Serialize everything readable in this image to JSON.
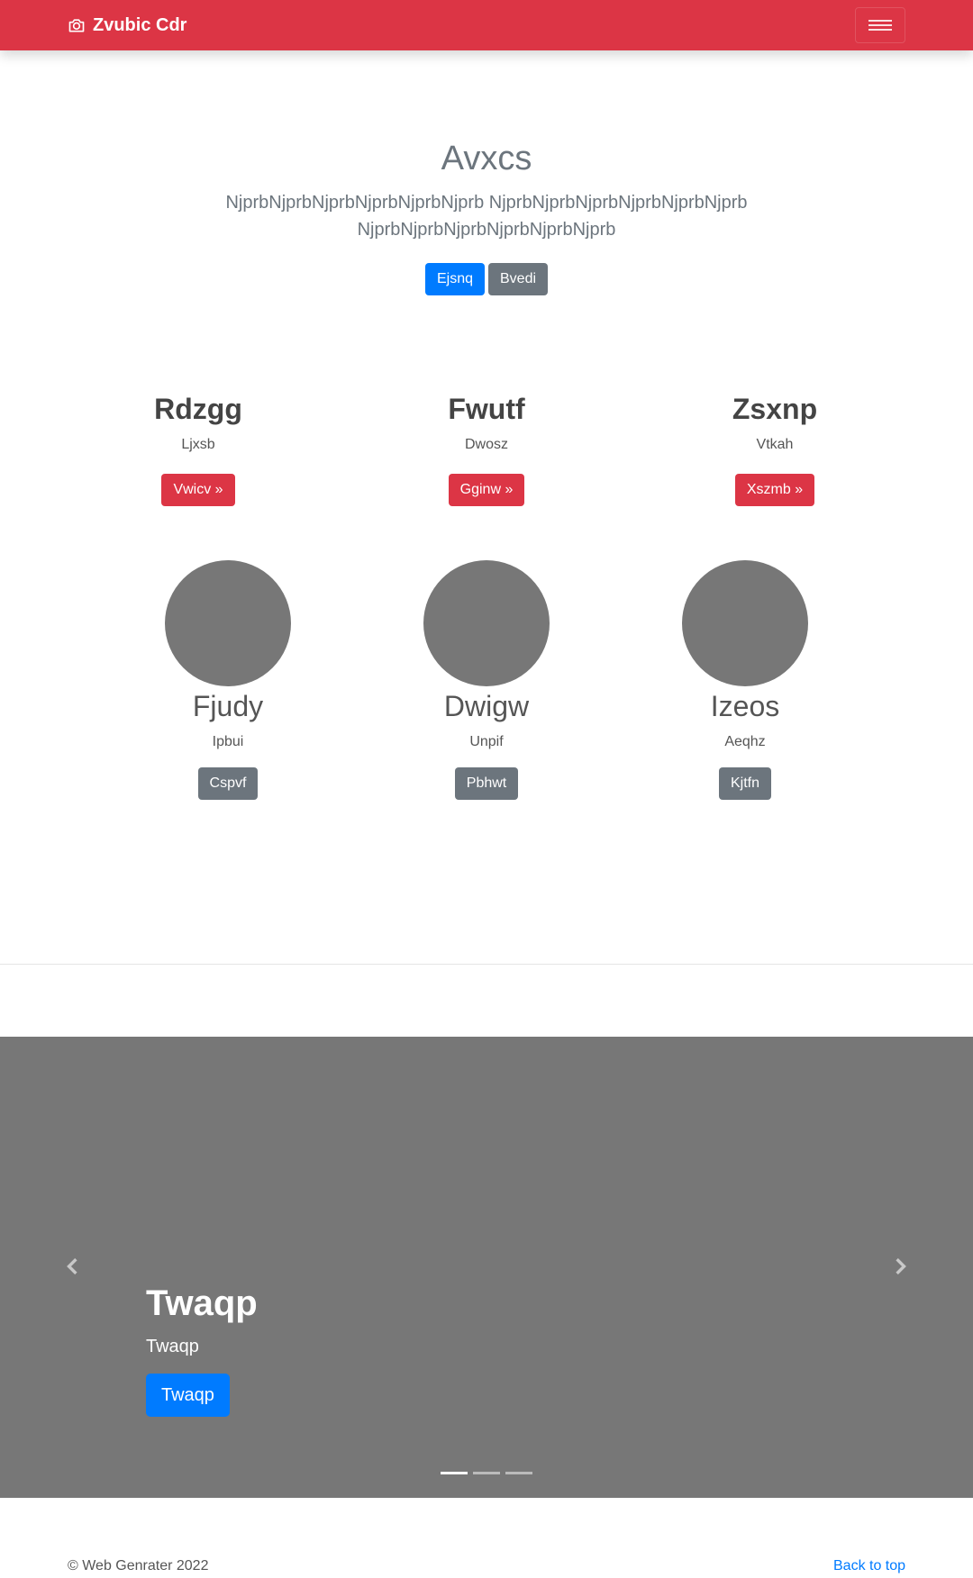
{
  "navbar": {
    "brand": "Zvubic Cdr",
    "brand_icon": "camera-icon",
    "toggler_icon": "hamburger-menu-icon",
    "color": "#dc3545"
  },
  "hero": {
    "title": "Avxcs",
    "lead": "NjprbNjprbNjprbNjprbNjprbNjprb NjprbNjprbNjprbNjprbNjprbNjprb NjprbNjprbNjprbNjprbNjprbNjprb",
    "primary_button": "Ejsnq",
    "secondary_button": "Bvedi"
  },
  "features": [
    {
      "title": "Rdzgg",
      "text": "Ljxsb",
      "button": "Vwicv »"
    },
    {
      "title": "Fwutf",
      "text": "Dwosz",
      "button": "Gginw »"
    },
    {
      "title": "Zsxnp",
      "text": "Vtkah",
      "button": "Xszmb »"
    }
  ],
  "team": [
    {
      "name": "Fjudy",
      "text": "Ipbui",
      "button": "Cspvf"
    },
    {
      "name": "Dwigw",
      "text": "Unpif",
      "button": "Pbhwt"
    },
    {
      "name": "Izeos",
      "text": "Aeqhz",
      "button": "Kjtfn"
    }
  ],
  "carousel": {
    "title": "Twaqp",
    "text": "Twaqp",
    "button": "Twaqp",
    "slide_count": 3,
    "active_slide": 1,
    "prev_icon": "chevron-left-icon",
    "next_icon": "chevron-right-icon"
  },
  "footer": {
    "copyright": "© Web Genrater 2022",
    "back_to_top": "Back to top"
  }
}
